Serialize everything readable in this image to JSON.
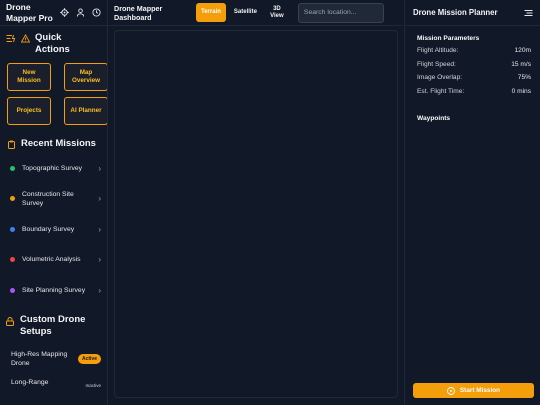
{
  "app": {
    "brand": "Drone Mapper Pro"
  },
  "sidebar": {
    "quick_actions_title": "Quick Actions",
    "quick_actions": [
      {
        "label": "New Mission"
      },
      {
        "label": "Map Overview"
      },
      {
        "label": "Projects"
      },
      {
        "label": "AI Planner"
      }
    ],
    "recent_missions_title": "Recent Missions",
    "recent_missions": [
      {
        "label": "Topographic Survey",
        "color": "#22c55e"
      },
      {
        "label": "Construction Site Survey",
        "color": "#f59e0b"
      },
      {
        "label": "Boundary Survey",
        "color": "#3b82f6"
      },
      {
        "label": "Volumetric Analysis",
        "color": "#ef4444"
      },
      {
        "label": "Site Planning Survey",
        "color": "#a855f7"
      }
    ],
    "custom_setups_title": "Custom Drone Setups",
    "custom_setups": [
      {
        "label": "High-Res Mapping Drone",
        "badge": "Active"
      },
      {
        "label": "Long-Range",
        "badge": "Inactive"
      }
    ]
  },
  "header": {
    "title": "Drone Mapper Dashboard",
    "views": [
      {
        "label": "Terrain",
        "active": true
      },
      {
        "label": "Satellite",
        "active": false
      },
      {
        "label": "3D View",
        "active": false
      }
    ],
    "search_placeholder": "Search location..."
  },
  "panel": {
    "title": "Drone Mission Planner",
    "params_title": "Mission Parameters",
    "params": [
      {
        "label": "Flight Altitude:",
        "value": "120m"
      },
      {
        "label": "Flight Speed:",
        "value": "15 m/s"
      },
      {
        "label": "Image Overlap:",
        "value": "75%"
      },
      {
        "label": "Est. Flight Time:",
        "value": "0 mins"
      }
    ],
    "waypoints_title": "Waypoints",
    "start_label": "Start Mission"
  },
  "colors": {
    "accent": "#f59e0b",
    "bg": "#111827"
  },
  "icons": [
    "settings-icon",
    "user-icon",
    "clock-icon",
    "quick-actions-icon",
    "warning-icon",
    "clipboard-icon",
    "lock-icon",
    "chevron-right-icon",
    "menu-icon",
    "play-circle-icon"
  ]
}
